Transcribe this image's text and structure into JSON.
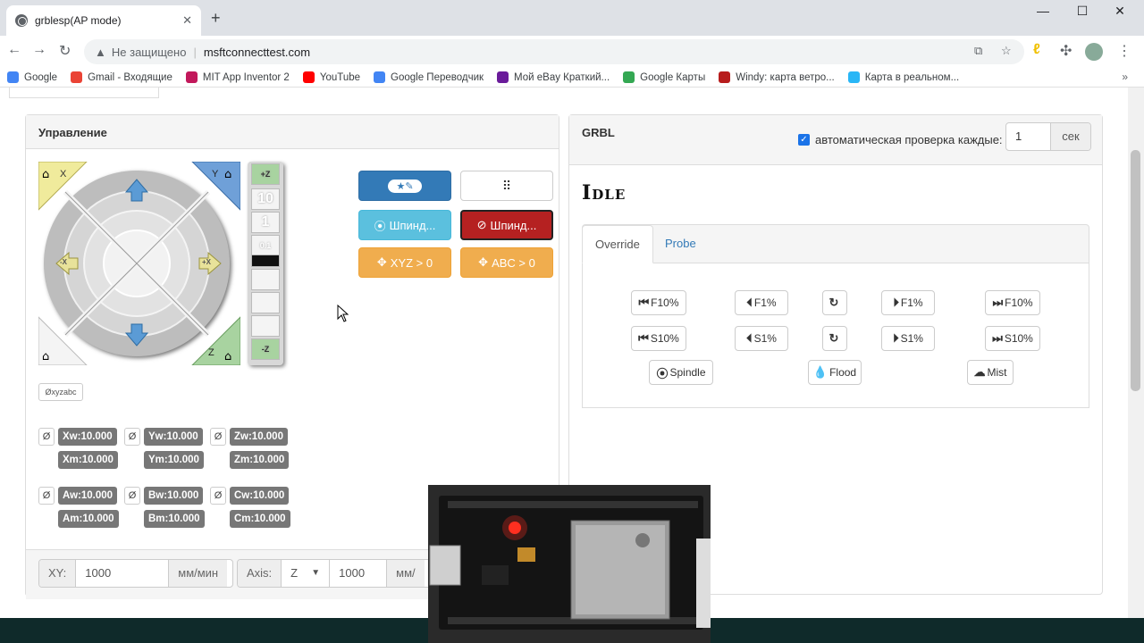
{
  "browser": {
    "tab_title": "grblesp(AP mode)",
    "tab_close": "✕",
    "new_tab": "+",
    "win_min": "—",
    "win_max": "☐",
    "win_close": "✕",
    "security_text": "Не защищено",
    "url": "msftconnecttest.com",
    "bookmarks": [
      "Google",
      "Gmail - Входящие",
      "MIT App Inventor 2",
      "YouTube",
      "Google Переводчик",
      "Мой eBay Краткий...",
      "Google Карты",
      "Windy: карта ветро...",
      "Карта в реальном..."
    ],
    "bookmark_colors": [
      "#4285f4",
      "#ea4335",
      "#c2185b",
      "#ff0000",
      "#4285f4",
      "#6a1b9a",
      "#34a853",
      "#b71c1c",
      "#29b6f6"
    ]
  },
  "control": {
    "title": "Управление",
    "jog": {
      "x_home": "X",
      "y_home": "Y",
      "z_home": "Z",
      "plus_x": "+X",
      "minus_x": "-X",
      "z_steps": [
        "10",
        "1",
        "0.1"
      ],
      "plus_z": "+Z",
      "minus_z": "-Z"
    },
    "reset_all": "Øxyzabc",
    "buttons": {
      "spindle_on": "Шпинд...",
      "spindle_off": "Шпинд...",
      "xyz_zero": "XYZ > 0",
      "abc_zero": "ABC > 0"
    },
    "axes": [
      {
        "zero": "Ø",
        "w": "Xw:10.000",
        "m": "Xm:10.000"
      },
      {
        "zero": "Ø",
        "w": "Yw:10.000",
        "m": "Ym:10.000"
      },
      {
        "zero": "Ø",
        "w": "Zw:10.000",
        "m": "Zm:10.000"
      },
      {
        "zero": "Ø",
        "w": "Aw:10.000",
        "m": "Am:10.000"
      },
      {
        "zero": "Ø",
        "w": "Bw:10.000",
        "m": "Bm:10.000"
      },
      {
        "zero": "Ø",
        "w": "Cw:10.000",
        "m": "Cm:10.000"
      }
    ],
    "feed": {
      "xy_label": "XY:",
      "xy_value": "1000",
      "xy_unit": "мм/мин",
      "axis_label": "Axis:",
      "axis_value": "Z",
      "axis_feed": "1000",
      "axis_unit": "мм/"
    }
  },
  "grbl": {
    "title": "GRBL",
    "auto_check_label": "автоматическая проверка каждые:",
    "auto_check_value": "1",
    "auto_check_unit": "сек",
    "state": "Idle",
    "tabs": [
      "Override",
      "Probe"
    ],
    "feed_row": [
      "F10%",
      "F1%",
      "",
      "F1%",
      "F10%"
    ],
    "speed_row": [
      "S10%",
      "S1%",
      "",
      "S1%",
      "S10%"
    ],
    "toggles": [
      "Spindle",
      "Flood",
      "Mist"
    ]
  }
}
